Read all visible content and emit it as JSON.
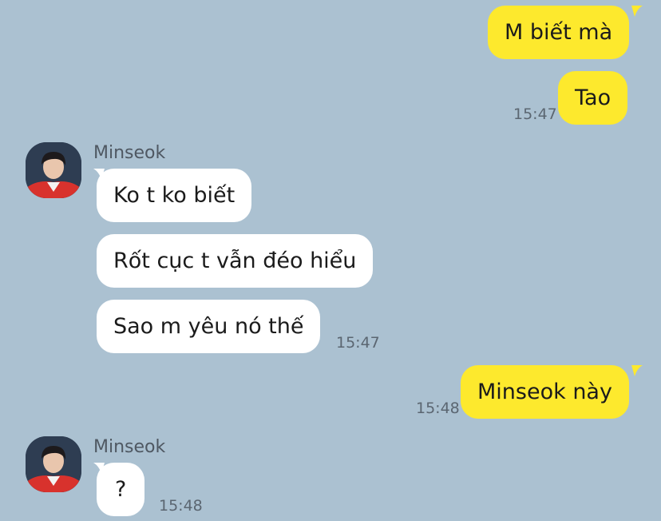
{
  "chat": {
    "messages": [
      {
        "direction": "sent",
        "text": "M biết mà"
      },
      {
        "direction": "sent",
        "text": "Tao",
        "time": "15:47"
      },
      {
        "direction": "received",
        "sender": "Minseok",
        "text": "Ko t ko biết"
      },
      {
        "direction": "received",
        "text": "Rốt cục t vẫn đéo hiểu"
      },
      {
        "direction": "received",
        "text": "Sao m yêu nó thế",
        "time": "15:47"
      },
      {
        "direction": "sent",
        "text": "Minseok này",
        "time": "15:48"
      },
      {
        "direction": "received",
        "sender": "Minseok",
        "text": "?",
        "time": "15:48"
      }
    ]
  },
  "colors": {
    "background": "#abc1d1",
    "sent_bubble": "#fde92d",
    "received_bubble": "#ffffff",
    "timestamp": "#5b6671"
  },
  "icons": {
    "avatar": "profile-photo-icon"
  }
}
